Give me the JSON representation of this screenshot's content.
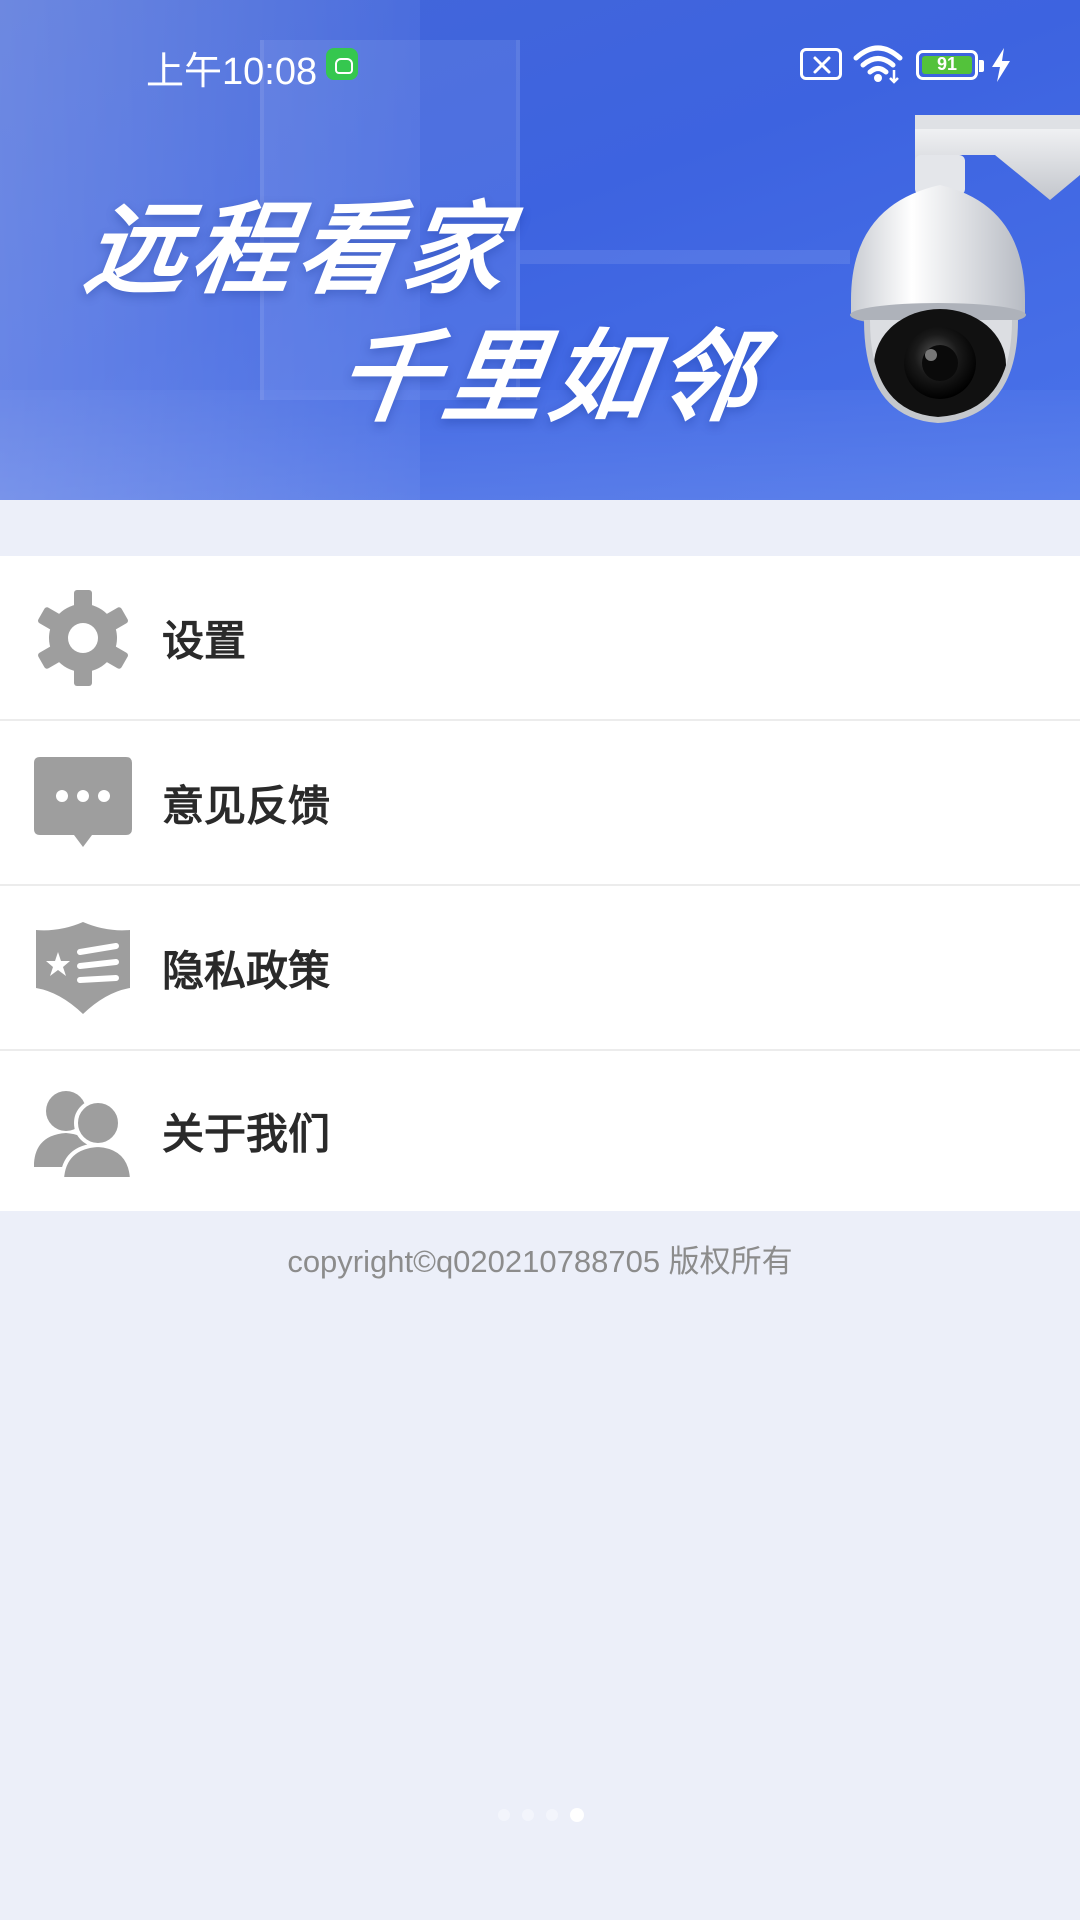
{
  "status_bar": {
    "time": "上午10:08",
    "battery_level": "91"
  },
  "banner": {
    "slogan_line1": "远程看家",
    "slogan_line2": "千里如邻"
  },
  "menu": {
    "items": [
      {
        "label": "设置",
        "icon": "gear-icon"
      },
      {
        "label": "意见反馈",
        "icon": "feedback-chat-icon"
      },
      {
        "label": "隐私政策",
        "icon": "privacy-shield-icon"
      },
      {
        "label": "关于我们",
        "icon": "users-icon"
      }
    ]
  },
  "footer": {
    "copyright": "copyright©q020210788705 版权所有"
  },
  "pager": {
    "page_count": 4,
    "active_index": 3
  },
  "colors": {
    "banner": "#3d63e0",
    "background": "#eceff9",
    "icon_gray": "#9e9e9e",
    "text": "#2a2a2a"
  }
}
